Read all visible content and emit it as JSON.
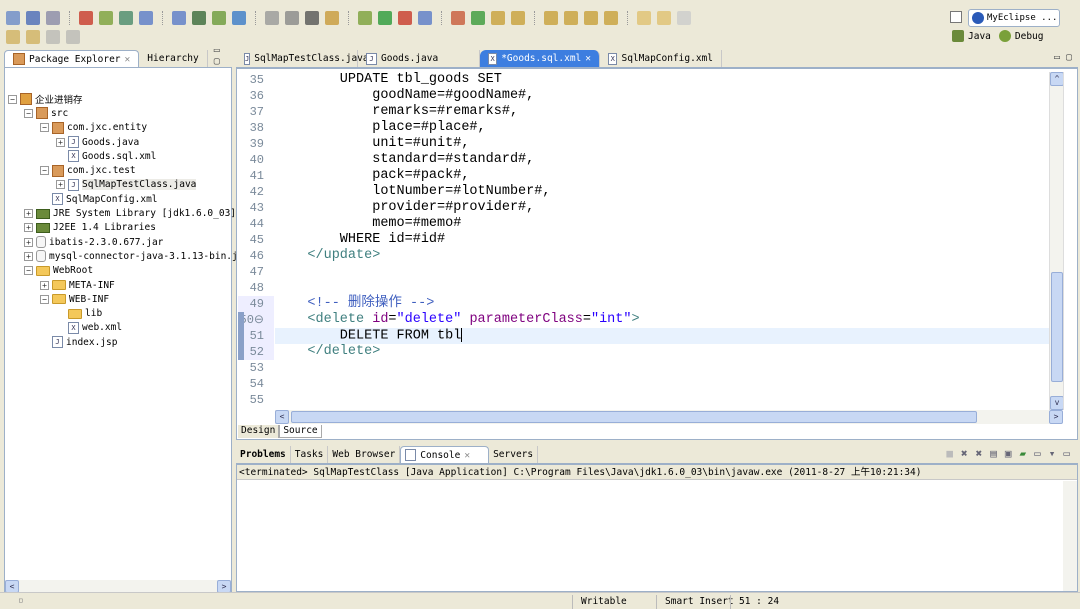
{
  "perspectives": {
    "current": "MyEclipse ...",
    "java": "Java",
    "debug": "Debug"
  },
  "left_panel": {
    "tabs": [
      {
        "label": "Package Explorer",
        "active": true
      },
      {
        "label": "Hierarchy",
        "active": false
      }
    ],
    "tree": [
      {
        "label": "企业进销存",
        "depth": 0,
        "exp": "-",
        "icon": "project"
      },
      {
        "label": "src",
        "depth": 1,
        "exp": "-",
        "icon": "pkg"
      },
      {
        "label": "com.jxc.entity",
        "depth": 2,
        "exp": "-",
        "icon": "pkg"
      },
      {
        "label": "Goods.java",
        "depth": 3,
        "exp": "+",
        "icon": "J"
      },
      {
        "label": "Goods.sql.xml",
        "depth": 3,
        "exp": "",
        "icon": "X"
      },
      {
        "label": "com.jxc.test",
        "depth": 2,
        "exp": "-",
        "icon": "pkg"
      },
      {
        "label": "SqlMapTestClass.java",
        "depth": 3,
        "exp": "+",
        "icon": "J",
        "selected": true
      },
      {
        "label": "SqlMapConfig.xml",
        "depth": 2,
        "exp": "",
        "icon": "X"
      },
      {
        "label": "JRE System Library [jdk1.6.0_03]",
        "depth": 1,
        "exp": "+",
        "icon": "lib"
      },
      {
        "label": "J2EE 1.4 Libraries",
        "depth": 1,
        "exp": "+",
        "icon": "lib"
      },
      {
        "label": "ibatis-2.3.0.677.jar",
        "depth": 1,
        "exp": "+",
        "icon": "jar"
      },
      {
        "label": "mysql-connector-java-3.1.13-bin.ja",
        "depth": 1,
        "exp": "+",
        "icon": "jar"
      },
      {
        "label": "WebRoot",
        "depth": 1,
        "exp": "-",
        "icon": "folder"
      },
      {
        "label": "META-INF",
        "depth": 2,
        "exp": "+",
        "icon": "folder"
      },
      {
        "label": "WEB-INF",
        "depth": 2,
        "exp": "-",
        "icon": "folder"
      },
      {
        "label": "lib",
        "depth": 3,
        "exp": "",
        "icon": "folder"
      },
      {
        "label": "web.xml",
        "depth": 3,
        "exp": "",
        "icon": "X"
      },
      {
        "label": "index.jsp",
        "depth": 2,
        "exp": "",
        "icon": "jsp"
      }
    ]
  },
  "editor": {
    "tabs": [
      {
        "label": "SqlMapTestClass.java",
        "icon": "J"
      },
      {
        "label": "Goods.java",
        "icon": "J"
      },
      {
        "label": "*Goods.sql.xml",
        "icon": "X",
        "active": true
      },
      {
        "label": "SqlMapConfig.xml",
        "icon": "X"
      }
    ],
    "colors": {
      "tag": "#3f7f7f",
      "attr": "#7f007f",
      "value": "#2a00ff",
      "comment": "#3f5fbf",
      "text": "#000000"
    },
    "current_line": 51,
    "lines": [
      {
        "n": 35,
        "s": [
          [
            "        UPDATE tbl_goods SET",
            "text"
          ]
        ]
      },
      {
        "n": 36,
        "s": [
          [
            "            goodName=#goodName#,",
            "text"
          ]
        ]
      },
      {
        "n": 37,
        "s": [
          [
            "            remarks=#remarks#,",
            "text"
          ]
        ]
      },
      {
        "n": 38,
        "s": [
          [
            "            place=#place#,",
            "text"
          ]
        ]
      },
      {
        "n": 39,
        "s": [
          [
            "            unit=#unit#,",
            "text"
          ]
        ]
      },
      {
        "n": 40,
        "s": [
          [
            "            standard=#standard#,",
            "text"
          ]
        ]
      },
      {
        "n": 41,
        "s": [
          [
            "            pack=#pack#,",
            "text"
          ]
        ]
      },
      {
        "n": 42,
        "s": [
          [
            "            lotNumber=#lotNumber#,",
            "text"
          ]
        ]
      },
      {
        "n": 43,
        "s": [
          [
            "            provider=#provider#,",
            "text"
          ]
        ]
      },
      {
        "n": 44,
        "s": [
          [
            "            memo=#memo#",
            "text"
          ]
        ]
      },
      {
        "n": 45,
        "s": [
          [
            "        WHERE id=#id#",
            "text"
          ]
        ]
      },
      {
        "n": 46,
        "s": [
          [
            "    </update>",
            "tag"
          ]
        ]
      },
      {
        "n": 47,
        "s": []
      },
      {
        "n": 48,
        "s": []
      },
      {
        "n": 49,
        "s": [
          [
            "    <!-- 删除操作 -->",
            "comment"
          ]
        ]
      },
      {
        "n": 50,
        "s": [
          [
            "    <delete ",
            "tag"
          ],
          [
            "id",
            "attr"
          ],
          [
            "=",
            "text"
          ],
          [
            "\"delete\"",
            "value"
          ],
          [
            " ",
            "text"
          ],
          [
            "parameterClass",
            "attr"
          ],
          [
            "=",
            "text"
          ],
          [
            "\"int\"",
            "value"
          ],
          [
            ">",
            "tag"
          ]
        ]
      },
      {
        "n": 51,
        "s": [
          [
            "        DELETE FROM tbl",
            "text"
          ]
        ]
      },
      {
        "n": 52,
        "s": [
          [
            "    </delete>",
            "tag"
          ]
        ]
      },
      {
        "n": 53,
        "s": []
      },
      {
        "n": 54,
        "s": []
      },
      {
        "n": 55,
        "s": []
      }
    ],
    "bottom_tabs": {
      "design": "Design",
      "source": "Source"
    }
  },
  "bottom_panel": {
    "tabs": [
      {
        "label": "Problems"
      },
      {
        "label": "Tasks"
      },
      {
        "label": "Web Browser"
      },
      {
        "label": "Console",
        "active": true
      },
      {
        "label": "Servers"
      }
    ],
    "console_header": "<terminated> SqlMapTestClass [Java Application] C:\\Program Files\\Java\\jdk1.6.0_03\\bin\\javaw.exe (2011-8-27 上午10:21:34)"
  },
  "status": {
    "writable": "Writable",
    "insert_mode": "Smart Insert",
    "position": "51 : 24"
  }
}
